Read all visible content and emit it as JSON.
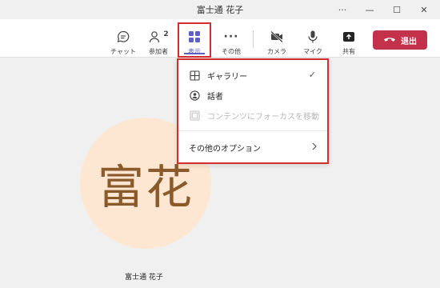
{
  "window": {
    "title": "富士通 花子",
    "controls": {
      "more": "···",
      "minimize": "—",
      "maximize": "☐",
      "close": "✕"
    }
  },
  "toolbar": {
    "chat_label": "チャット",
    "participants_label": "参加者",
    "participants_count": "2",
    "view_label": "表示",
    "more_label": "その他",
    "camera_label": "カメラ",
    "mic_label": "マイク",
    "share_label": "共有",
    "leave_label": "退出"
  },
  "view_menu": {
    "items": [
      {
        "label": "ギャラリー",
        "icon": "grid-icon",
        "selected": true
      },
      {
        "label": "話者",
        "icon": "speaker-icon",
        "selected": false
      },
      {
        "label": "コンテンツにフォーカスを移動",
        "icon": "content-focus-icon",
        "disabled": true
      }
    ],
    "more_options_label": "その他のオプション"
  },
  "stage": {
    "avatar_initials": "富花",
    "participant_name": "富士通 花子"
  },
  "colors": {
    "accent": "#5b5fc7",
    "leave": "#c4314b",
    "highlight_box": "#d32f2f",
    "avatar_bg": "#fde7d2",
    "avatar_text": "#8a5a2b"
  }
}
